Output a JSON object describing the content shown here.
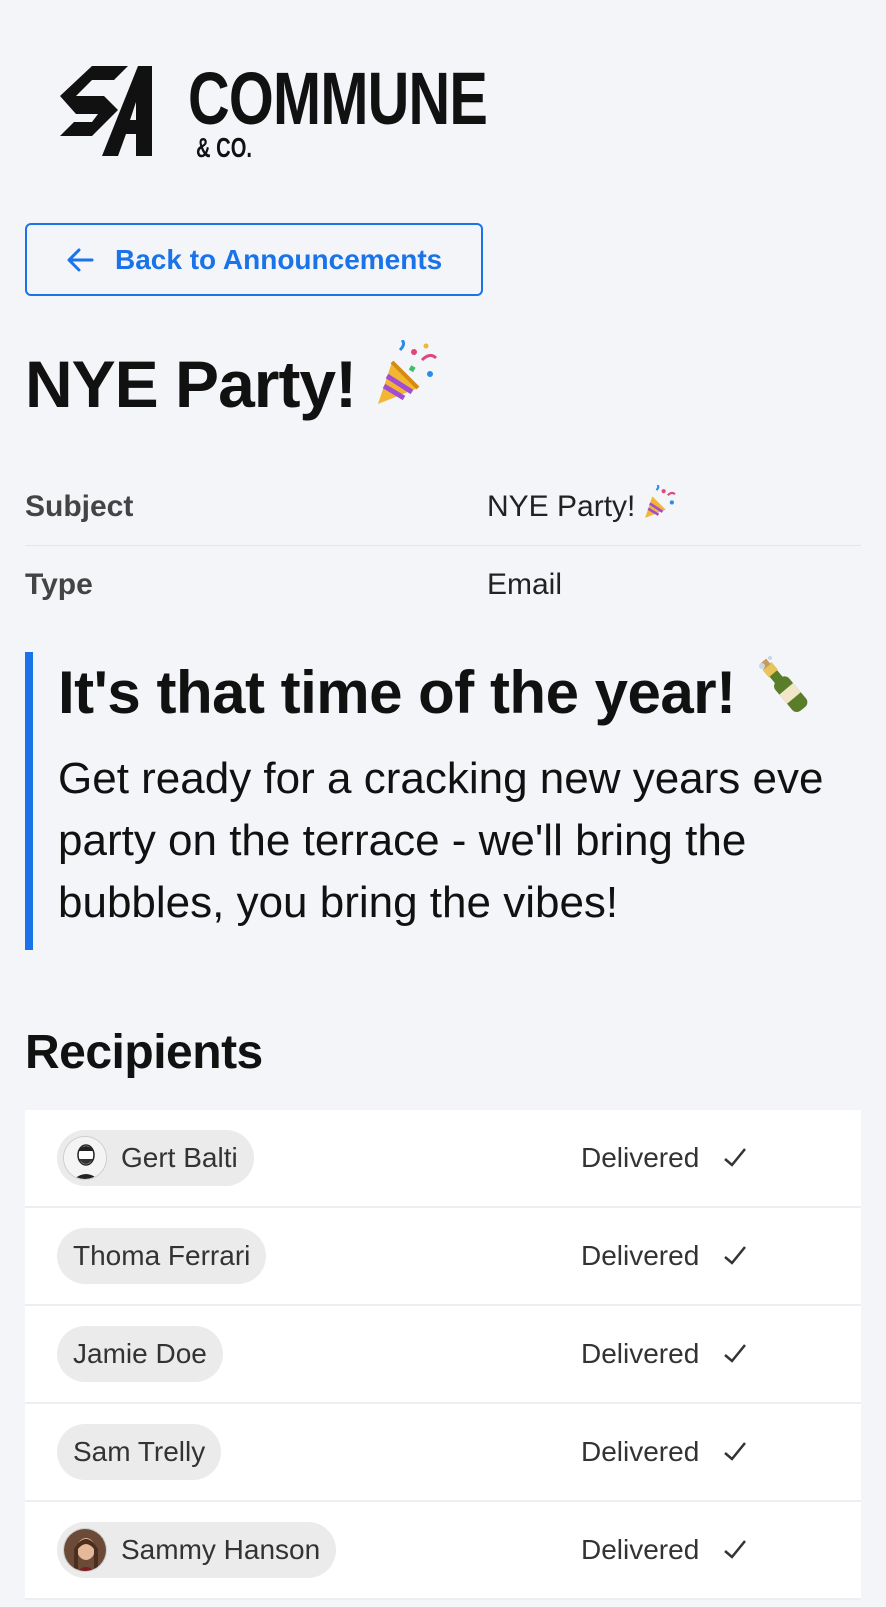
{
  "brand": {
    "name": "COMMUNE",
    "sub": "& CO."
  },
  "back_button": {
    "label": "Back to Announcements"
  },
  "title": {
    "text": "NYE Party!",
    "emoji": "party-popper"
  },
  "meta": [
    {
      "label": "Subject",
      "value": "NYE Party!",
      "emoji": "party-popper"
    },
    {
      "label": "Type",
      "value": "Email"
    }
  ],
  "message": {
    "heading": "It's that time of the year!",
    "heading_emoji": "champagne-bottle",
    "body": "Get ready for a cracking new years eve party on the terrace - we'll bring the bubbles, you bring the vibes!"
  },
  "recipients": {
    "title": "Recipients",
    "items": [
      {
        "name": "Gert Balti",
        "status": "Delivered",
        "avatar": true
      },
      {
        "name": "Thoma Ferrari",
        "status": "Delivered",
        "avatar": false
      },
      {
        "name": "Jamie Doe",
        "status": "Delivered",
        "avatar": false
      },
      {
        "name": "Sam Trelly",
        "status": "Delivered",
        "avatar": false
      },
      {
        "name": "Sammy Hanson",
        "status": "Delivered",
        "avatar": true
      }
    ]
  },
  "colors": {
    "accent": "#1a73e8",
    "background": "#f3f5f8"
  }
}
